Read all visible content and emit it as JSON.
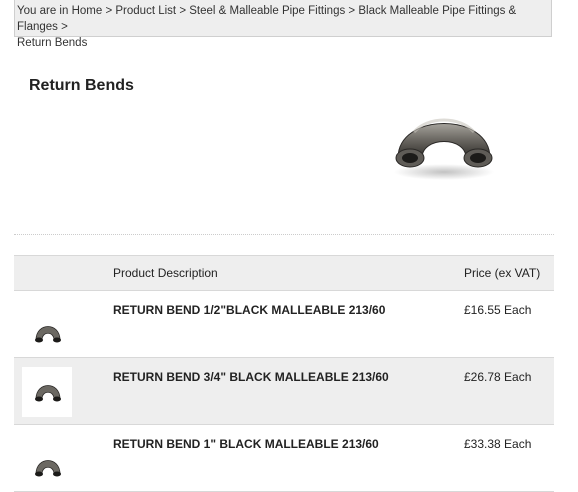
{
  "breadcrumb": {
    "prefix": "You are in",
    "items": [
      "Home",
      "Product List",
      "Steel & Malleable Pipe Fittings",
      "Black Malleable Pipe Fittings & Flanges",
      "Return Bends"
    ],
    "separator": ">"
  },
  "page": {
    "title": "Return Bends"
  },
  "table": {
    "headers": {
      "image": "",
      "description": "Product Description",
      "price": "Price (ex VAT)"
    },
    "rows": [
      {
        "description": "RETURN BEND 1/2\"BLACK MALLEABLE 213/60",
        "price": "£16.55 Each",
        "thumb_framed": false
      },
      {
        "description": "RETURN BEND 3/4\" BLACK MALLEABLE 213/60",
        "price": "£26.78 Each",
        "thumb_framed": true
      },
      {
        "description": "RETURN BEND 1\" BLACK MALLEABLE 213/60",
        "price": "£33.38 Each",
        "thumb_framed": false
      }
    ]
  },
  "colors": {
    "panel_bg": "#eeeeee",
    "border": "#d8d8d8",
    "text": "#222222"
  }
}
